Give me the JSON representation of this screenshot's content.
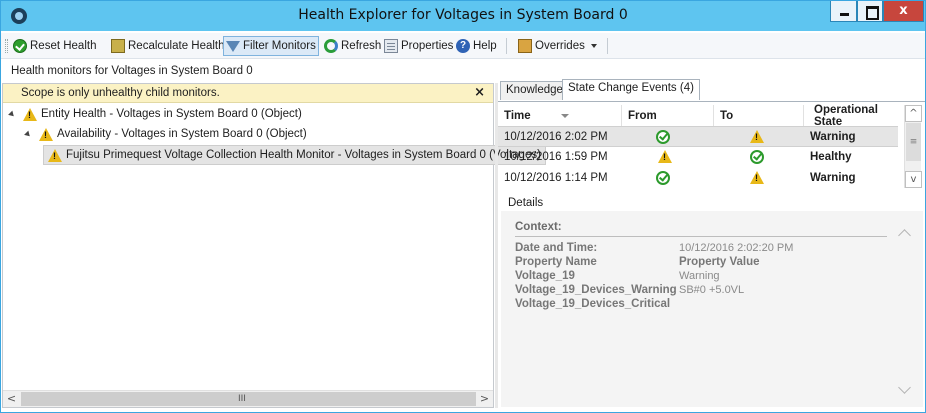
{
  "window": {
    "title": "Health Explorer for Voltages in System Board 0",
    "close_label": "x"
  },
  "toolbar": {
    "reset_health": "Reset Health",
    "recalculate_health": "Recalculate Health",
    "filter_monitors": "Filter Monitors",
    "refresh": "Refresh",
    "properties": "Properties",
    "help": "Help",
    "overrides": "Overrides"
  },
  "header": {
    "subtitle": "Health monitors for Voltages in System Board 0"
  },
  "left": {
    "scope_text": "Scope is only unhealthy child monitors.",
    "scope_close": "×",
    "tree": [
      {
        "label": "Entity Health - Voltages in System Board 0 (Object)",
        "state": "warning"
      },
      {
        "label": "Availability - Voltages in System Board 0 (Object)",
        "state": "warning"
      },
      {
        "label": "Fujitsu Primequest Voltage Collection Health Monitor - Voltages in System Board 0 (Voltages)",
        "state": "warning"
      }
    ],
    "scroll_grip": "III"
  },
  "right": {
    "tabs": [
      {
        "label": "Knowledge"
      },
      {
        "label": "State Change Events (4)"
      }
    ],
    "columns": [
      "Time",
      "From",
      "To",
      "Operational State"
    ],
    "rows": [
      {
        "time": "10/12/2016 2:02 PM",
        "from": "healthy",
        "to": "warning",
        "state": "Warning"
      },
      {
        "time": "10/12/2016 1:59 PM",
        "from": "warning",
        "to": "healthy",
        "state": "Healthy"
      },
      {
        "time": "10/12/2016 1:14 PM",
        "from": "healthy",
        "to": "warning",
        "state": "Warning"
      }
    ],
    "details_label": "Details",
    "context": {
      "title": "Context:",
      "rows": [
        {
          "key": "Date and Time:",
          "value": "10/12/2016 2:02:20 PM"
        },
        {
          "key": "Property Name",
          "value": "Property Value"
        },
        {
          "key": "Voltage_19",
          "value": "Warning"
        },
        {
          "key": "Voltage_19_Devices_Warning",
          "value": "SB#0 +5.0VL"
        },
        {
          "key": "Voltage_19_Devices_Critical",
          "value": ""
        }
      ]
    }
  },
  "colors": {
    "titlebar": "#5ec5f0",
    "scope_bar": "#fbf2c4",
    "warning": "#e8b818",
    "healthy": "#2c9a2c",
    "close_button": "#c7463d"
  }
}
